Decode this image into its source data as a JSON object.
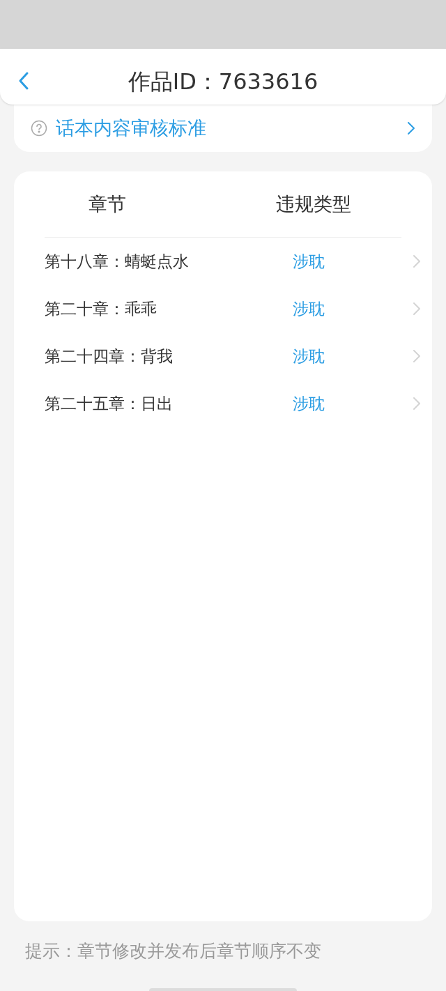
{
  "header": {
    "title": "作品ID：7633616"
  },
  "guide_link": {
    "label": "话本内容审核标准"
  },
  "table": {
    "columns": [
      "章节",
      "违规类型"
    ],
    "rows": [
      {
        "chapter": "第十八章：蜻蜓点水",
        "violation": "涉耽"
      },
      {
        "chapter": "第二十章：乖乖",
        "violation": "涉耽"
      },
      {
        "chapter": "第二十四章：背我",
        "violation": "涉耽"
      },
      {
        "chapter": "第二十五章：日出",
        "violation": "涉耽"
      }
    ]
  },
  "hint": "提示：章节修改并发布后章节顺序不变"
}
